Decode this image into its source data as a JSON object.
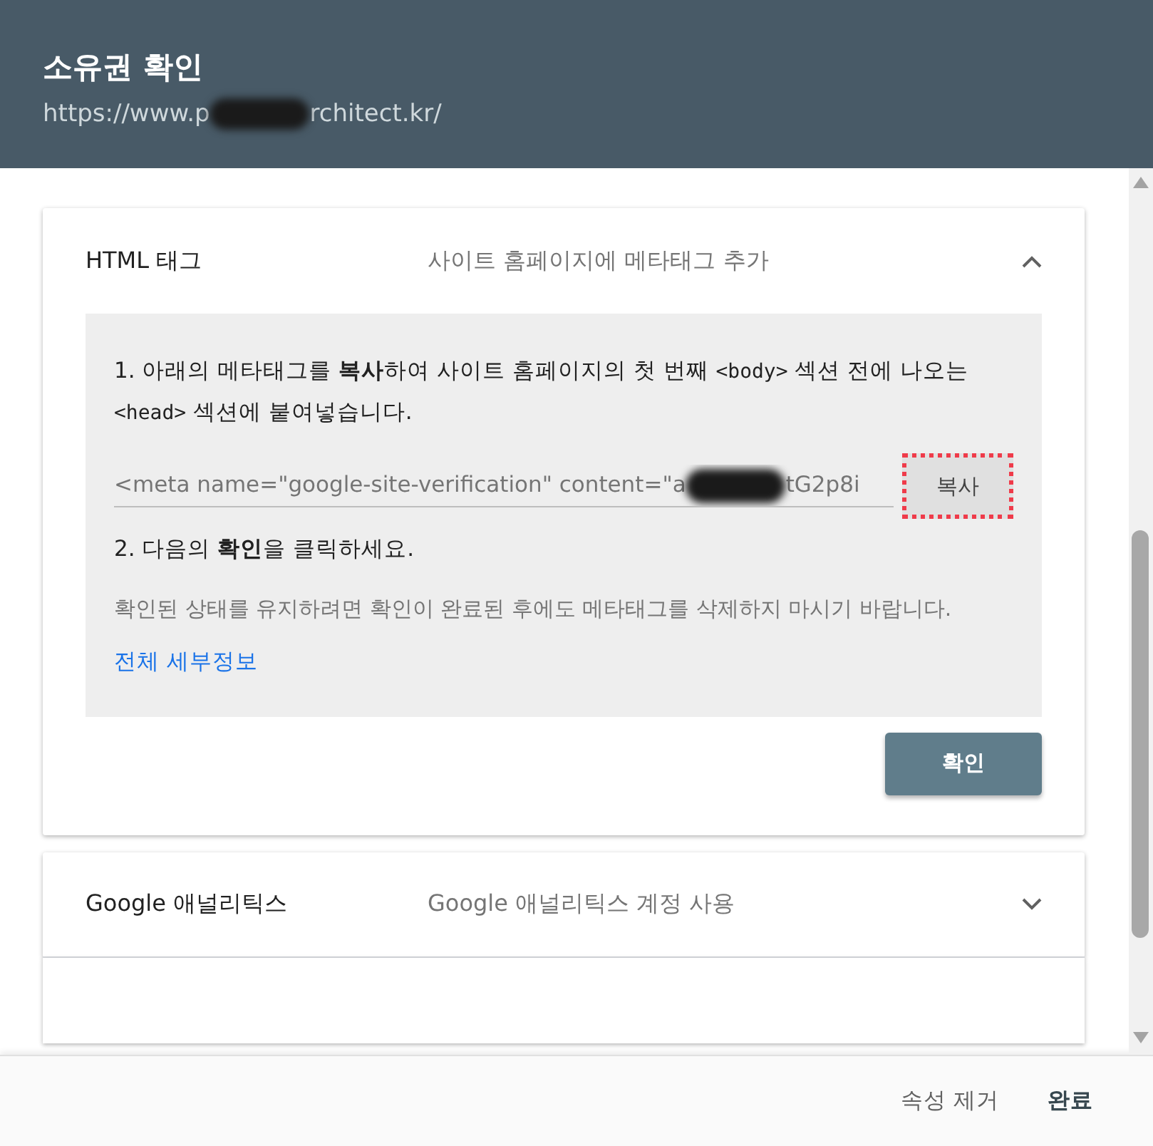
{
  "header": {
    "title": "소유권 확인",
    "url_start": "https://www.p",
    "url_end": "rchitect.kr/"
  },
  "methods": [
    {
      "name": "HTML 태그",
      "description": "사이트 홈페이지에 메타태그 추가",
      "expanded": true,
      "step1": "1. 아래의 메타태그를 **복사**하여 사이트 홈페이지의 첫 번째 <body> 섹션 전에 나오는 <head> 섹션에 붙여넣습니다.",
      "meta_start": "<meta name=\"google-site-verification\" content=\"a",
      "meta_end": "tG2p8i",
      "copy_button": {
        "label": "복사",
        "highlighted": true
      },
      "step2": "2. 다음의 **확인**을 클릭하세요.",
      "note": "확인된 상태를 유지하려면 확인이 완료된 후에도 메타태그를 삭제하지 마시기 바랍니다.",
      "link": "전체 세부정보",
      "verify_button": "확인"
    },
    {
      "name": "Google 애널리틱스",
      "description": "Google 애널리틱스 계정 사용",
      "expanded": false
    }
  ],
  "footer": {
    "buttons": [
      {
        "label": "속성 제거",
        "kind": "secondary"
      },
      {
        "label": "완료",
        "kind": "primary"
      }
    ]
  }
}
